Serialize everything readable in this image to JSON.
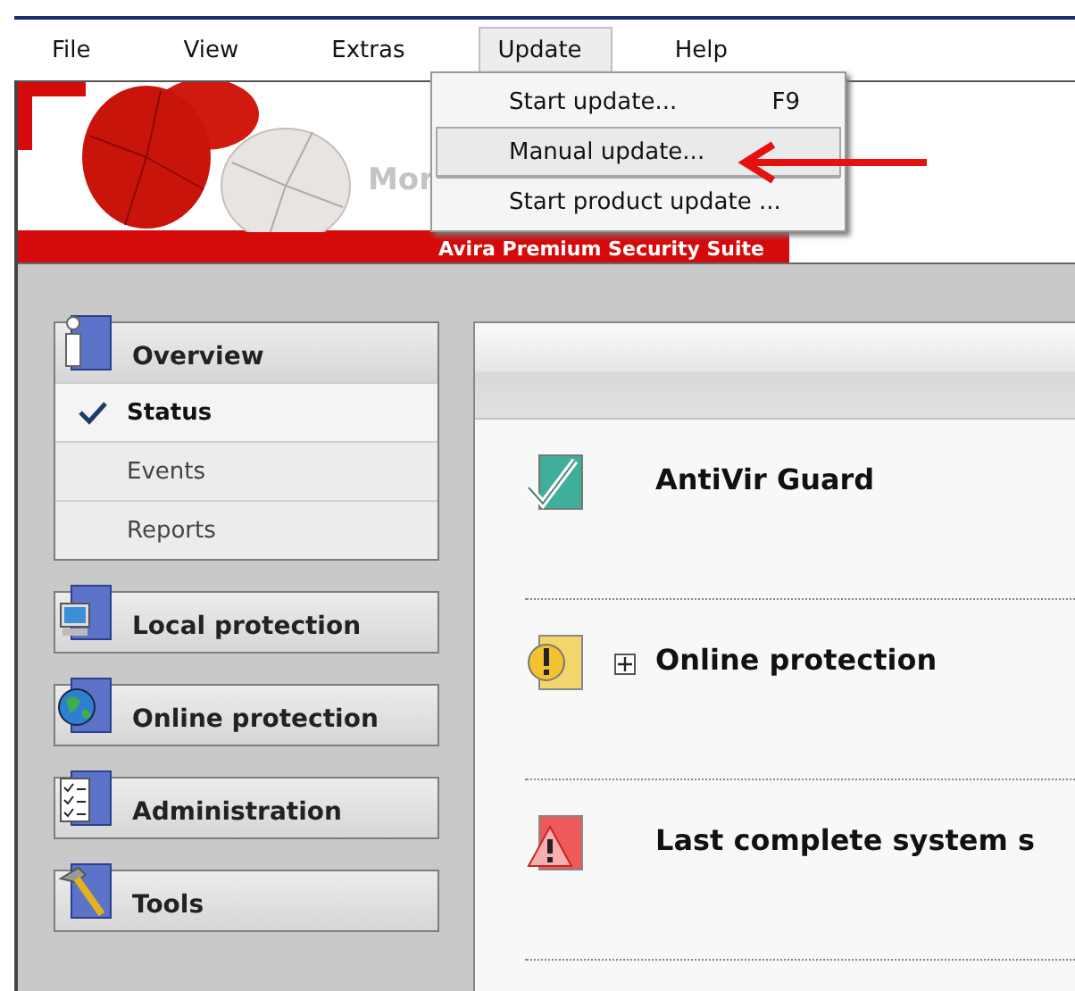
{
  "menu_bar": {
    "items": [
      {
        "label": "File",
        "selected": false
      },
      {
        "label": "View",
        "selected": false
      },
      {
        "label": "Extras",
        "selected": false
      },
      {
        "label": "Update",
        "selected": true
      },
      {
        "label": "Help",
        "selected": false
      }
    ]
  },
  "update_menu": {
    "items": [
      {
        "label": "Start update...",
        "shortcut": "F9",
        "selected": false
      },
      {
        "label": "Manual update...",
        "selected": true
      },
      {
        "label": "Start product update ...",
        "selected": false
      }
    ]
  },
  "banner": {
    "tagline": "Mor",
    "product": "Avira Premium Security Suite"
  },
  "sidebar": {
    "groups": [
      {
        "label": "Overview",
        "children": [
          {
            "label": "Status",
            "selected": true
          },
          {
            "label": "Events",
            "selected": false
          },
          {
            "label": "Reports",
            "selected": false
          }
        ]
      },
      {
        "label": "Local protection"
      },
      {
        "label": "Online protection"
      },
      {
        "label": "Administration"
      },
      {
        "label": "Tools"
      }
    ]
  },
  "status": {
    "rows": [
      {
        "label": "AntiVir Guard",
        "kind": "ok",
        "expandable": false
      },
      {
        "label": "Online protection",
        "kind": "warning",
        "expandable": true
      },
      {
        "label": "Last complete system s",
        "kind": "error",
        "expandable": false
      }
    ]
  }
}
